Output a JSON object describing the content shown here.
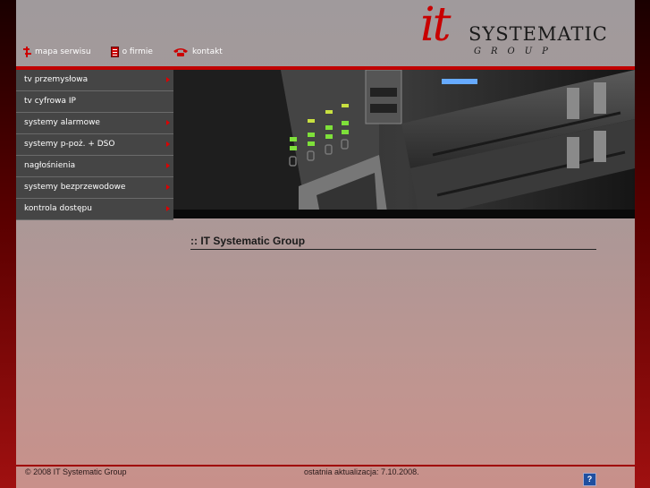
{
  "topnav": {
    "sitemap": "mapa serwisu",
    "about": "o firmie",
    "contact": "kontakt"
  },
  "logo": {
    "it": "it",
    "systematic": "SYSTEMATIC",
    "group": "GROUP"
  },
  "menu": [
    {
      "label": "tv przemysłowa",
      "arrow": true
    },
    {
      "label": "tv cyfrowa IP",
      "arrow": false
    },
    {
      "label": "systemy alarmowe",
      "arrow": true
    },
    {
      "label": "systemy p-poż. + DSO",
      "arrow": true
    },
    {
      "label": "nagłośnienia",
      "arrow": true
    },
    {
      "label": "systemy bezprzewodowe",
      "arrow": true
    },
    {
      "label": "kontrola dostępu",
      "arrow": true
    }
  ],
  "content": {
    "title": ":: IT Systematic Group"
  },
  "footer": {
    "copyright": "© 2008 IT Systematic Group",
    "updated": "ostatnia aktualizacja: 7.10.2008.",
    "help": "?"
  },
  "colors": {
    "accent": "#c00000",
    "menu_bg": "#454545"
  }
}
